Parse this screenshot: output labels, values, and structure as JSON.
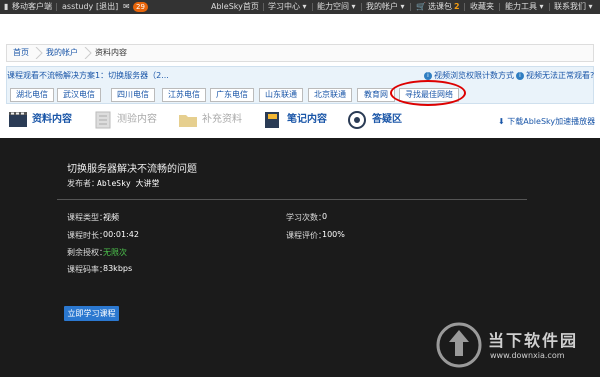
{
  "topbar": {
    "mobile_client": "移动客户端",
    "username": "asstudy",
    "logout": "[退出]",
    "message_count": "29",
    "home": "AbleSky首页",
    "study_center": "学习中心",
    "ability_space": "能力空间",
    "my_account": "我的帐户",
    "cart_label": "选课包",
    "cart_count": "2",
    "favorites": "收藏夹",
    "tools": "能力工具",
    "contact": "联系我们"
  },
  "breadcrumb": [
    "首页",
    "我的帐户",
    "资料内容"
  ],
  "notice": {
    "title": "课程观看不流畅解决方案1：切换服务器（2...",
    "link1": "视频浏览权限计数方式",
    "link2": "视频无法正常观看?"
  },
  "routes": [
    "湖北电信",
    "武汉电信",
    "四川电信",
    "江苏电信",
    "广东电信",
    "山东联通",
    "北京联通",
    "教育网",
    "寻找最佳网络"
  ],
  "tabs": [
    {
      "label": "资料内容"
    },
    {
      "label": "测验内容"
    },
    {
      "label": "补充资料"
    },
    {
      "label": "笔记内容"
    },
    {
      "label": "答疑区"
    }
  ],
  "download_player": "下载AbleSky加速播放器",
  "course": {
    "title": "切换服务器解决不流畅的问题",
    "publisher_label": "发布者：",
    "publisher": "AbleSky 大讲堂",
    "type_label": "课程类型：",
    "type": "视频",
    "duration_label": "课程时长：",
    "duration": "00:01:42",
    "license_label": "剩余授权：",
    "license": "无限次",
    "bitrate_label": "课程码率：",
    "bitrate": "83kbps",
    "study_count_label": "学习次数：",
    "study_count": "0",
    "rating_label": "课程评价：",
    "rating": "100%",
    "start_button": "立即学习课程"
  },
  "watermark": {
    "name": "当下软件园",
    "url": "www.downxia.com"
  },
  "colors": {
    "accent": "#2b78d0",
    "link": "#1a56a8",
    "highlight": "#dd0000",
    "dark_bg": "#1b1b1b"
  }
}
